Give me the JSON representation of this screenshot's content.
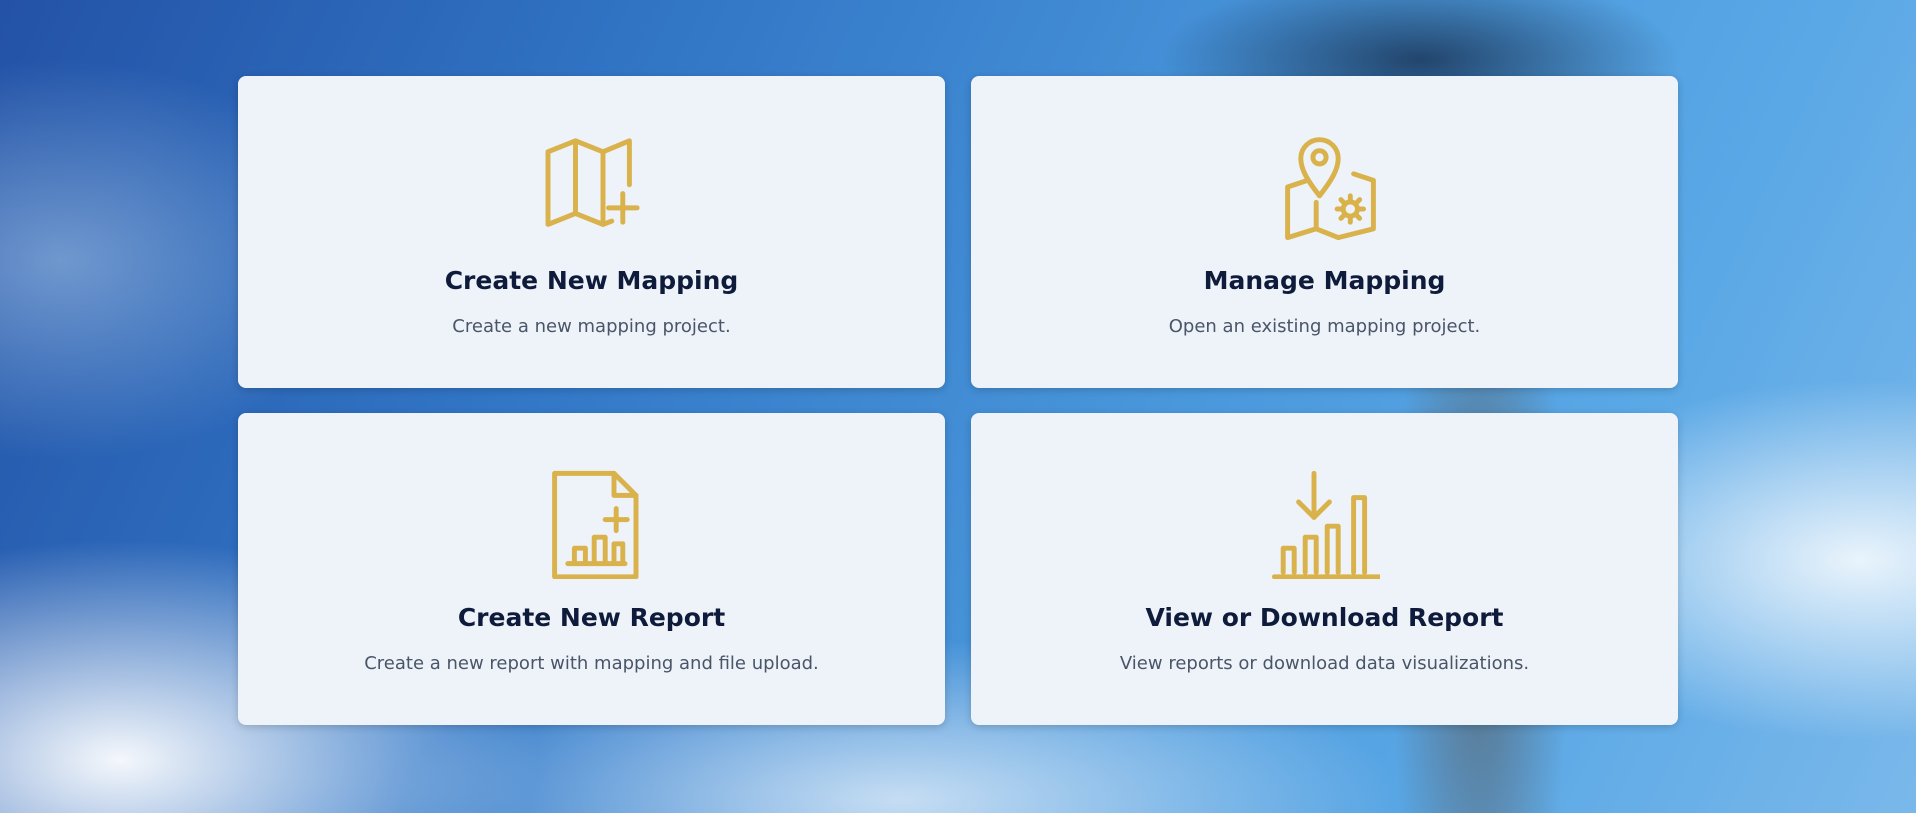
{
  "theme": {
    "icon_color": "#d9b24c",
    "card_background": "#eef3fa",
    "title_color": "#0f1b3a",
    "description_color": "#4a5568"
  },
  "cards": [
    {
      "title": "Create New Mapping",
      "description": "Create a new mapping project.",
      "icon": "map-plus-icon"
    },
    {
      "title": "Manage Mapping",
      "description": "Open an existing mapping project.",
      "icon": "map-pin-gear-icon"
    },
    {
      "title": "Create New Report",
      "description": "Create a new report with mapping and file upload.",
      "icon": "file-chart-plus-icon"
    },
    {
      "title": "View or Download Report",
      "description": "View reports or download data visualizations.",
      "icon": "chart-download-icon"
    }
  ]
}
